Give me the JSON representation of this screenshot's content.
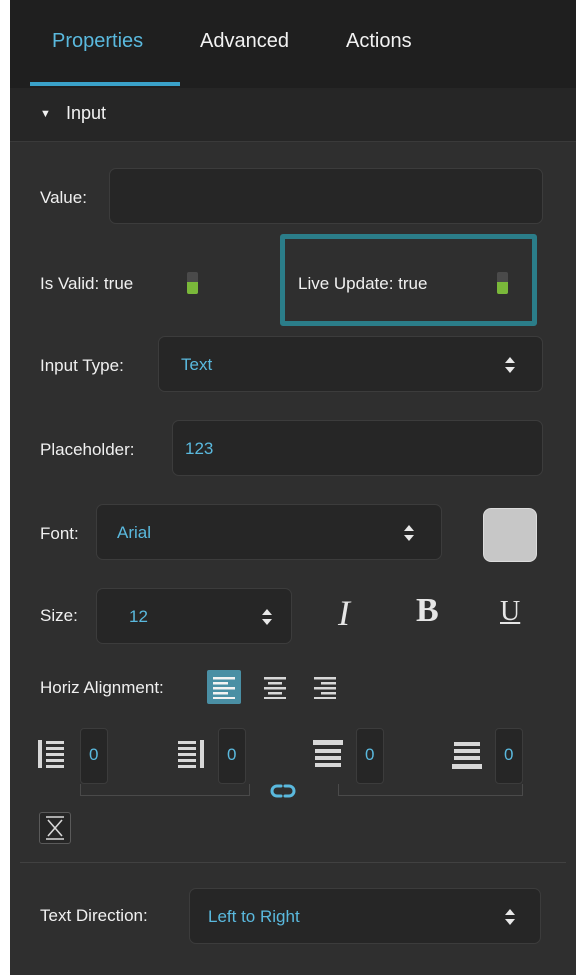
{
  "tabs": [
    {
      "label": "Properties",
      "active": true
    },
    {
      "label": "Advanced",
      "active": false
    },
    {
      "label": "Actions",
      "active": false
    }
  ],
  "section": {
    "title": "Input",
    "expanded": true
  },
  "value_field": {
    "label": "Value:",
    "value": ""
  },
  "is_valid": {
    "label": "Is Valid: true",
    "state": true
  },
  "live_update": {
    "label": "Live Update: true",
    "state": true,
    "highlighted": true
  },
  "input_type": {
    "label": "Input Type:",
    "selected": "Text"
  },
  "placeholder": {
    "label": "Placeholder:",
    "value": "123"
  },
  "font": {
    "label": "Font:",
    "selected": "Arial",
    "color": "#c7c7c7"
  },
  "size": {
    "label": "Size:",
    "selected": "12"
  },
  "text_style": {
    "italic": "I",
    "bold": "B",
    "underline": "U"
  },
  "horiz_alignment": {
    "label": "Horiz Alignment:",
    "selected": "left",
    "options": [
      "left",
      "center",
      "right"
    ]
  },
  "padding": {
    "left": "0",
    "right": "0",
    "top": "0",
    "bottom": "0",
    "linked_icon": "link-icon"
  },
  "text_direction": {
    "label": "Text Direction:",
    "selected": "Left to Right"
  },
  "colors": {
    "accent": "#5ab9de",
    "panel": "#2f2f2f",
    "tab_bar": "#1f1f1f",
    "toggle_on": "#7ab83a",
    "highlight": "#2b7d89"
  }
}
